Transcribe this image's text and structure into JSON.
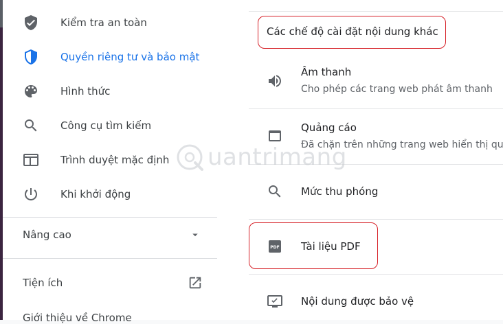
{
  "sidebar": {
    "items": [
      {
        "label": "Kiểm tra an toàn",
        "icon": "shield-check-icon"
      },
      {
        "label": "Quyền riêng tư và bảo mật",
        "icon": "privacy-shield-icon"
      },
      {
        "label": "Hình thức",
        "icon": "palette-icon"
      },
      {
        "label": "Công cụ tìm kiếm",
        "icon": "search-icon"
      },
      {
        "label": "Trình duyệt mặc định",
        "icon": "browser-window-icon"
      },
      {
        "label": "Khi khởi động",
        "icon": "power-icon"
      }
    ],
    "advanced_label": "Nâng cao",
    "extensions_label": "Tiện ích",
    "about_label": "Giới thiệu về Chrome"
  },
  "content": {
    "heading": "Các chế độ cài đặt nội dung khác",
    "rows": [
      {
        "title": "Âm thanh",
        "subtitle": "Cho phép các trang web phát âm thanh",
        "icon": "speaker-icon"
      },
      {
        "title": "Quảng cáo",
        "subtitle": "Đã chặn trên những trang web hiển thị qu",
        "icon": "window-icon"
      },
      {
        "title": "Mức thu phóng",
        "icon": "zoom-icon"
      },
      {
        "title": "Tài liệu PDF",
        "icon": "pdf-icon"
      },
      {
        "title": "Nội dung được bảo vệ",
        "icon": "protected-content-icon"
      }
    ]
  },
  "watermark": "uantrimang",
  "colors": {
    "accent": "#1a73e8",
    "highlight": "#d61f26",
    "icon": "#5f6368"
  }
}
